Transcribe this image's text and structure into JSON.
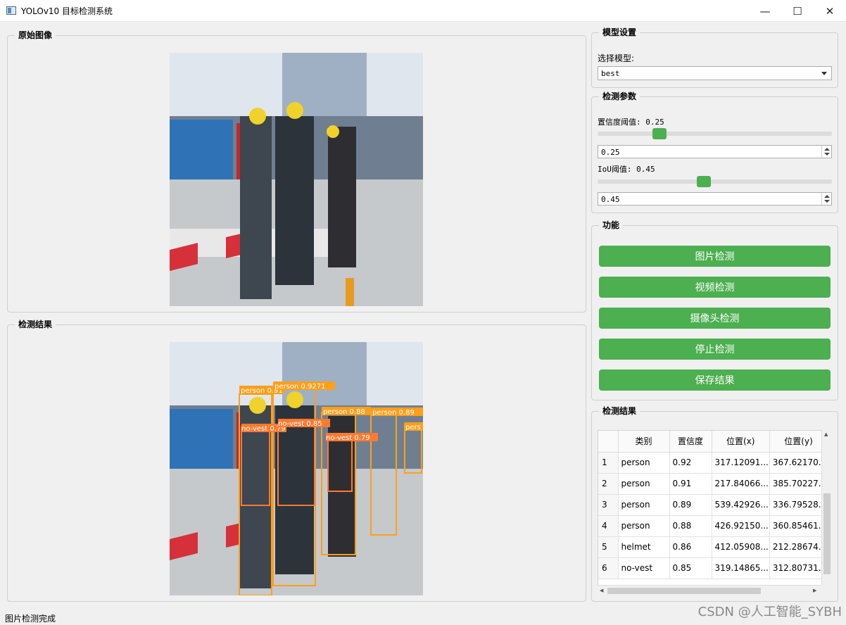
{
  "window": {
    "title": "YOLOv10 目标检测系统",
    "minimize": "—",
    "maximize": "☐",
    "close": "✕"
  },
  "original_panel": {
    "title": "原始图像"
  },
  "result_panel": {
    "title": "检测结果"
  },
  "model_settings": {
    "title": "模型设置",
    "select_label": "选择模型:",
    "selected_model": "best"
  },
  "detect_params": {
    "title": "检测参数",
    "conf_label": "置信度阈值: 0.25",
    "conf_value": "0.25",
    "conf_fraction": 0.25,
    "iou_label": "IoU阈值: 0.45",
    "iou_value": "0.45",
    "iou_fraction": 0.45
  },
  "functions": {
    "title": "功能",
    "buttons": [
      "图片检测",
      "视频检测",
      "摄像头检测",
      "停止检测",
      "保存结果"
    ]
  },
  "results_table": {
    "title": "检测结果",
    "headers": [
      "类别",
      "置信度",
      "位置(x)",
      "位置(y)"
    ],
    "rows": [
      {
        "index": "1",
        "cells": [
          "person",
          "0.92",
          "317.12091...",
          "367.62170..."
        ]
      },
      {
        "index": "2",
        "cells": [
          "person",
          "0.91",
          "217.84066...",
          "385.70227..."
        ]
      },
      {
        "index": "3",
        "cells": [
          "person",
          "0.89",
          "539.42926...",
          "336.79528..."
        ]
      },
      {
        "index": "4",
        "cells": [
          "person",
          "0.88",
          "426.92150...",
          "360.85461..."
        ]
      },
      {
        "index": "5",
        "cells": [
          "helmet",
          "0.86",
          "412.05908...",
          "212.28674..."
        ]
      },
      {
        "index": "6",
        "cells": [
          "no-vest",
          "0.85",
          "319.14865...",
          "312.80731..."
        ]
      }
    ]
  },
  "detection_labels": [
    "person 0.91",
    "person 0.9271",
    "person 0.88",
    "person 0.89",
    "no-vest 0.79",
    "no-vest 0.85",
    "no-vest 0.79",
    "pers"
  ],
  "status": "图片检测完成",
  "watermark": "CSDN @人工智能_SYBH",
  "colors": {
    "accent": "#4caf50",
    "box_orange": "#ff9f1a",
    "box_red": "#ff3b3b"
  }
}
